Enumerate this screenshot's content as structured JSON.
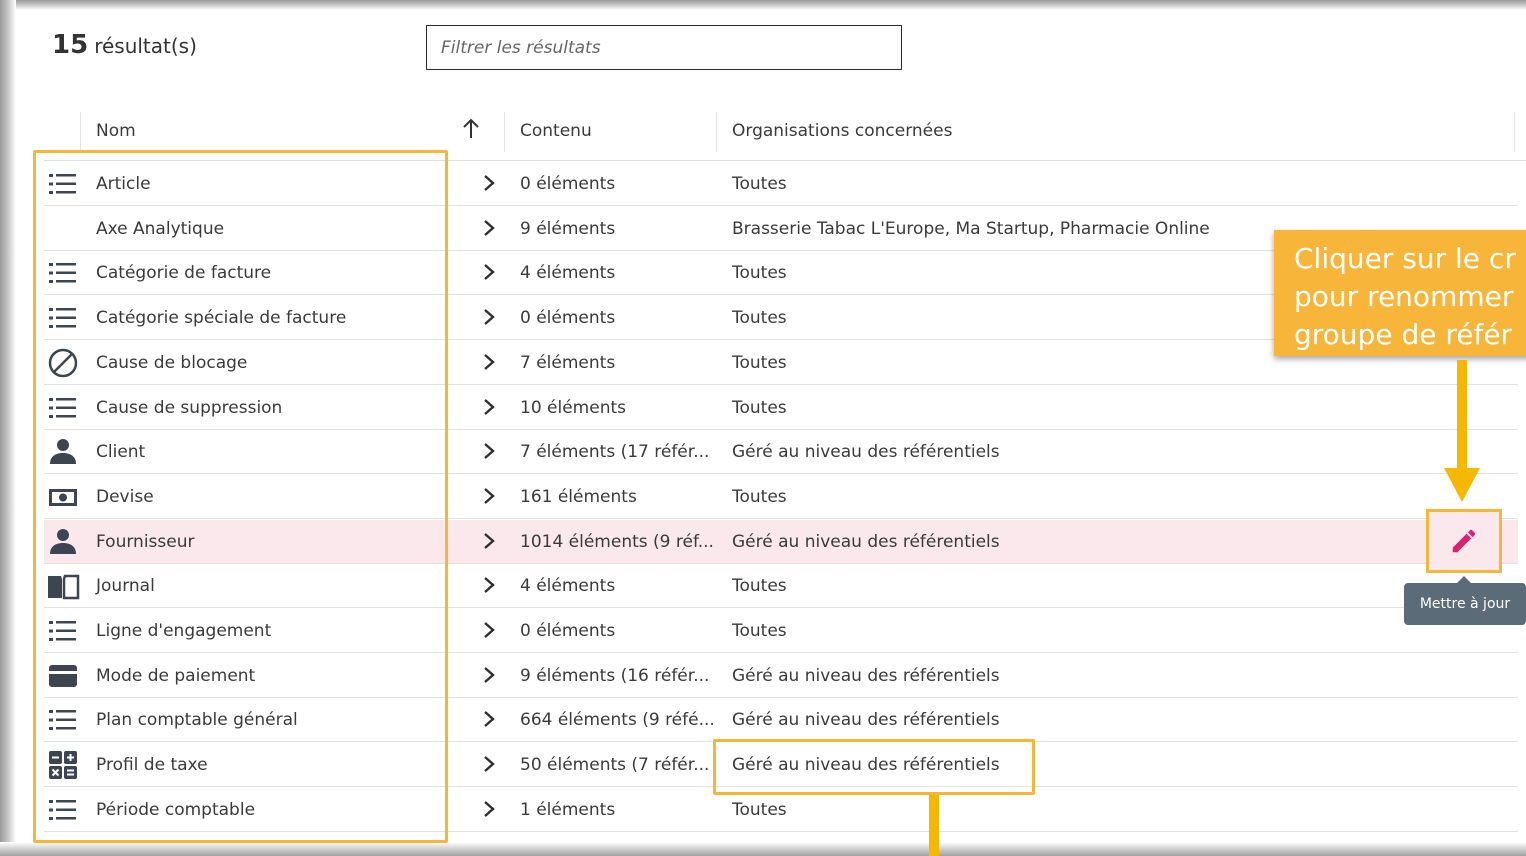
{
  "results": {
    "count": "15",
    "label": "résultat(s)"
  },
  "filter": {
    "placeholder": "Filtrer les résultats",
    "value": ""
  },
  "columns": {
    "name": "Nom",
    "content": "Contenu",
    "orgs": "Organisations concernées"
  },
  "rows": [
    {
      "icon": "list-icon",
      "name": "Article",
      "content": "0 éléments",
      "orgs": "Toutes"
    },
    {
      "icon": "",
      "name": "Axe Analytique",
      "content": "9 éléments",
      "orgs": "Brasserie Tabac L'Europe, Ma Startup, Pharmacie Online"
    },
    {
      "icon": "list-icon",
      "name": "Catégorie de facture",
      "content": "4 éléments",
      "orgs": "Toutes"
    },
    {
      "icon": "list-icon",
      "name": "Catégorie spéciale de facture",
      "content": "0 éléments",
      "orgs": "Toutes"
    },
    {
      "icon": "blocked-icon",
      "name": "Cause de blocage",
      "content": "7 éléments",
      "orgs": "Toutes"
    },
    {
      "icon": "list-icon",
      "name": "Cause de suppression",
      "content": "10 éléments",
      "orgs": "Toutes"
    },
    {
      "icon": "person-icon",
      "name": "Client",
      "content": "7 éléments (17 référ...",
      "orgs": "Géré au niveau des référentiels"
    },
    {
      "icon": "money-icon",
      "name": "Devise",
      "content": "161 éléments",
      "orgs": "Toutes"
    },
    {
      "icon": "person-icon",
      "name": "Fournisseur",
      "content": "1014 éléments (9 réf...",
      "orgs": "Géré au niveau des référentiels"
    },
    {
      "icon": "book-icon",
      "name": "Journal",
      "content": "4 éléments",
      "orgs": "Toutes"
    },
    {
      "icon": "list-icon",
      "name": "Ligne d'engagement",
      "content": "0 éléments",
      "orgs": "Toutes"
    },
    {
      "icon": "card-icon",
      "name": "Mode de paiement",
      "content": "9 éléments (16 référ...",
      "orgs": "Géré au niveau des référentiels"
    },
    {
      "icon": "list-icon",
      "name": "Plan comptable général",
      "content": "664 éléments (9 réfé...",
      "orgs": "Géré au niveau des référentiels"
    },
    {
      "icon": "calculator-icon",
      "name": "Profil de taxe",
      "content": "50 éléments (7 référ...",
      "orgs": "Géré au niveau des référentiels"
    },
    {
      "icon": "list-icon",
      "name": "Période comptable",
      "content": "1 éléments",
      "orgs": "Toutes"
    }
  ],
  "callout": {
    "line1": "Cliquer sur le cr",
    "line2": "pour renommer",
    "line3": "groupe de référ"
  },
  "tooltip": "Mettre à jour",
  "colors": {
    "highlight": "#f5b73a",
    "selected_row": "#fbe8ec",
    "edit_icon": "#d6246e",
    "tooltip": "#5b6b78"
  }
}
